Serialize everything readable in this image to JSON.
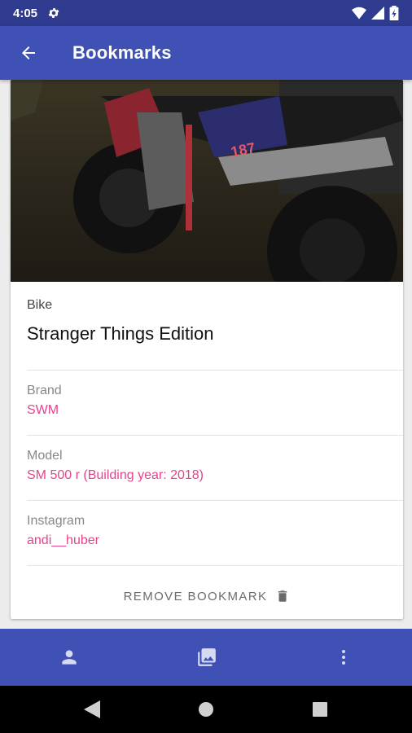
{
  "status_bar": {
    "time": "4:05"
  },
  "app_bar": {
    "title": "Bookmarks"
  },
  "card": {
    "category": "Bike",
    "title": "Stranger Things Edition",
    "fields": [
      {
        "label": "Brand",
        "value": "SWM"
      },
      {
        "label": "Model",
        "value": "SM 500 r (Building year: 2018)"
      },
      {
        "label": "Instagram",
        "value": "andi__huber"
      }
    ],
    "remove_label": "REMOVE BOOKMARK"
  },
  "colors": {
    "primary": "#3f51b5",
    "primary_dark": "#2f3b8f",
    "accent": "#e7438b"
  }
}
